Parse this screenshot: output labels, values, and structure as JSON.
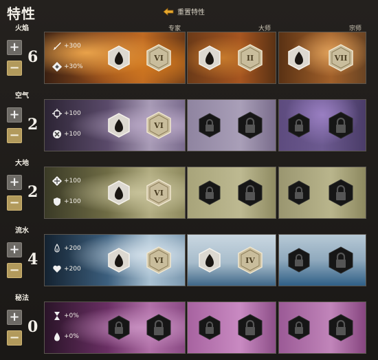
{
  "header": {
    "title": "特性",
    "reset_label": "重置特性"
  },
  "tiers": [
    "专家",
    "大师",
    "宗师"
  ],
  "colors": {
    "fire": "#b5541c",
    "air": "#7e5aa0",
    "earth": "#8a8a4e",
    "water": "#4f7fa6",
    "arcane": "#9a4a8e",
    "minus_button": "#b29a5c",
    "plus_button": "#6d6a65"
  },
  "lines": [
    {
      "name": "火焰",
      "points": "6",
      "stats": [
        {
          "icon": "power-sword-icon",
          "value": "+300"
        },
        {
          "icon": "condition-damage-icon",
          "value": "+30%"
        }
      ],
      "tier_nodes": [
        {
          "state": "unlocked",
          "rank": "VI"
        },
        {
          "state": "unlocked",
          "rank": "II"
        },
        {
          "state": "unlocked",
          "rank": "VII"
        }
      ]
    },
    {
      "name": "空气",
      "points": "2",
      "stats": [
        {
          "icon": "precision-crosshair-icon",
          "value": "+100"
        },
        {
          "icon": "ferocity-x-icon",
          "value": "+100"
        }
      ],
      "tier_nodes": [
        {
          "state": "unlocked",
          "rank": "VI"
        },
        {
          "state": "locked",
          "rank": ""
        },
        {
          "state": "locked",
          "rank": ""
        }
      ]
    },
    {
      "name": "大地",
      "points": "2",
      "stats": [
        {
          "icon": "toughness-icon",
          "value": "+100"
        },
        {
          "icon": "vitality-shield-icon",
          "value": "+100"
        }
      ],
      "tier_nodes": [
        {
          "state": "unlocked",
          "rank": "VI"
        },
        {
          "state": "locked",
          "rank": ""
        },
        {
          "state": "locked",
          "rank": ""
        }
      ]
    },
    {
      "name": "流水",
      "points": "4",
      "stats": [
        {
          "icon": "healing-power-icon",
          "value": "+200"
        },
        {
          "icon": "heart-icon",
          "value": "+200"
        }
      ],
      "tier_nodes": [
        {
          "state": "unlocked",
          "rank": "VI"
        },
        {
          "state": "unlocked",
          "rank": "IV"
        },
        {
          "state": "locked",
          "rank": ""
        }
      ]
    },
    {
      "name": "秘法",
      "points": "0",
      "stats": [
        {
          "icon": "hourglass-icon",
          "value": "+0%"
        },
        {
          "icon": "drop-icon",
          "value": "+0%"
        }
      ],
      "tier_nodes": [
        {
          "state": "locked",
          "rank": ""
        },
        {
          "state": "locked",
          "rank": ""
        },
        {
          "state": "locked",
          "rank": ""
        }
      ]
    }
  ]
}
